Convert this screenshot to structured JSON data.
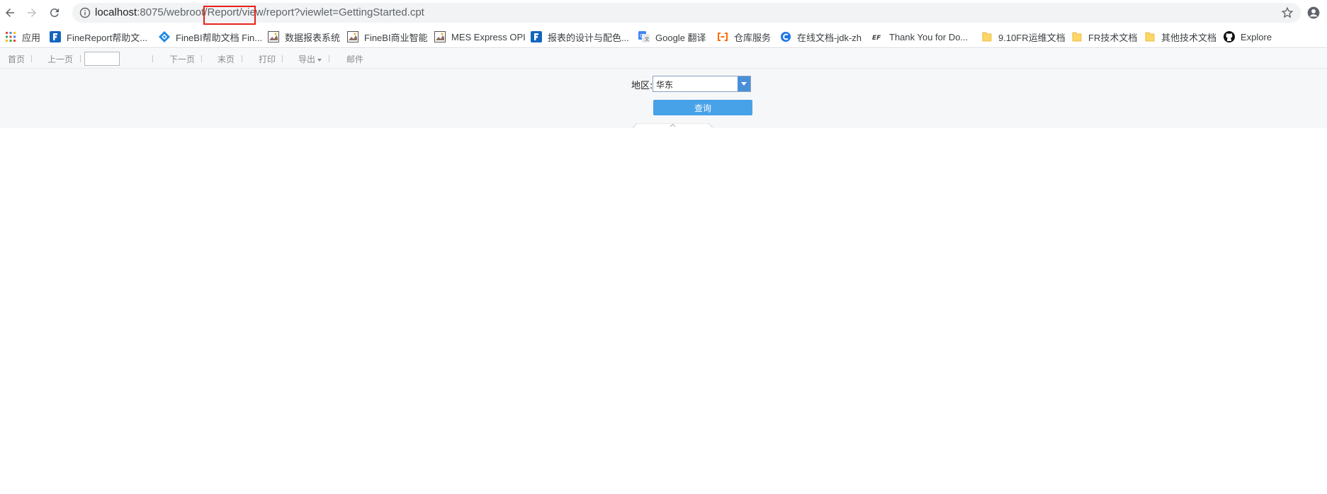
{
  "browser": {
    "url_host": "localhost",
    "url_rest": ":8075/webroot/Report/view/report?viewlet=GettingStarted.cpt"
  },
  "bookmarks": [
    {
      "label": "应用",
      "icon": "apps-grid-icon"
    },
    {
      "label": "FineReport帮助文...",
      "icon": "finereport-icon"
    },
    {
      "label": "FineBI帮助文档 Fin...",
      "icon": "finebi-icon"
    },
    {
      "label": "数据报表系统",
      "icon": "report-image-icon"
    },
    {
      "label": "FineBI商业智能",
      "icon": "report-image-icon"
    },
    {
      "label": "MES Express OPI",
      "icon": "report-image-icon"
    },
    {
      "label": "报表的设计与配色...",
      "icon": "finereport-icon"
    },
    {
      "label": "Google 翻译",
      "icon": "google-translate-icon"
    },
    {
      "label": "仓库服务",
      "icon": "aliyun-icon"
    },
    {
      "label": "在线文档-jdk-zh",
      "icon": "c-logo-icon"
    },
    {
      "label": "Thank You for Do...",
      "icon": "ef-logo-icon"
    },
    {
      "label": "9.10FR运维文档",
      "icon": "folder-icon"
    },
    {
      "label": "FR技术文档",
      "icon": "folder-icon"
    },
    {
      "label": "其他技术文档",
      "icon": "folder-icon"
    },
    {
      "label": "Explore",
      "icon": "github-icon"
    }
  ],
  "report_toolbar": {
    "first": "首页",
    "prev": "上一页",
    "next": "下一页",
    "last": "末页",
    "print": "打印",
    "export": "导出",
    "email": "邮件"
  },
  "params": {
    "region_label": "地区:",
    "region_value": "华东",
    "query_label": "查询"
  },
  "colors": {
    "query_button": "#47a2e8",
    "highlight_box": "#e8221b"
  }
}
